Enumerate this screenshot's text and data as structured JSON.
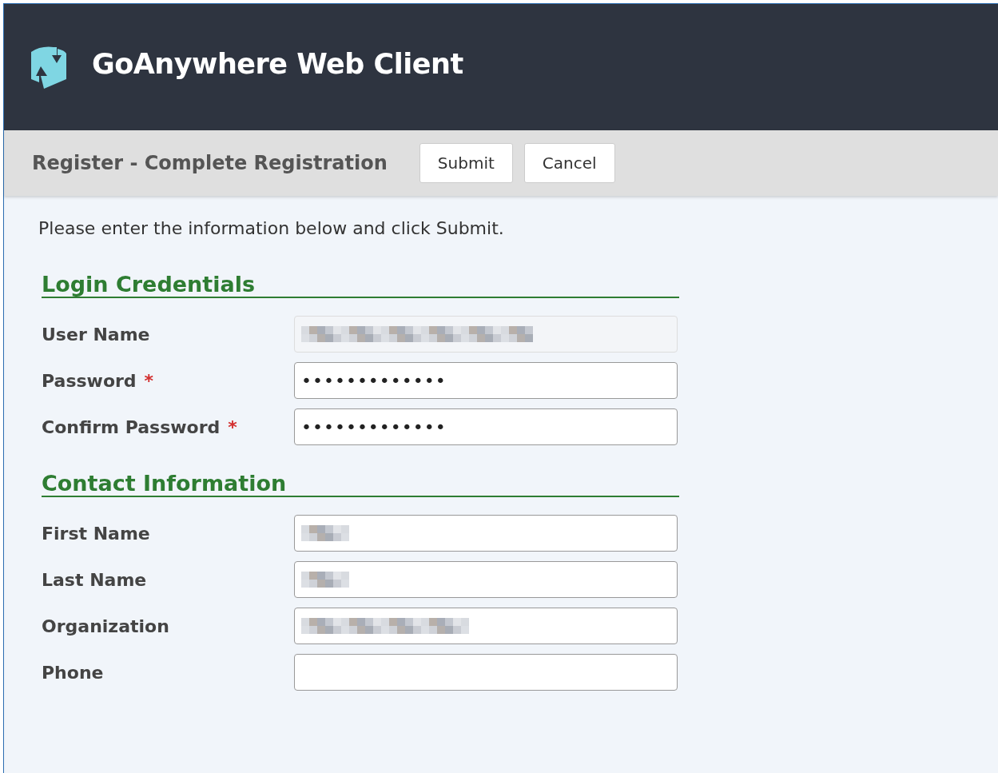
{
  "header": {
    "title": "GoAnywhere Web Client"
  },
  "toolbar": {
    "title": "Register - Complete Registration",
    "buttons": [
      "Submit",
      "Cancel"
    ]
  },
  "intro": "Please enter the information below and click Submit.",
  "sections": [
    {
      "title": "Login Credentials",
      "fields": [
        {
          "label": "User Name",
          "kind": "longblur",
          "disabled": true
        },
        {
          "label": "Password",
          "marker": "*",
          "kind": "text",
          "disabled": false,
          "value": "•••••••••••••"
        },
        {
          "label": "Confirm Password",
          "marker": "*",
          "kind": "text",
          "disabled": false,
          "value": "•••••••••••••"
        }
      ]
    },
    {
      "title": "Contact Information",
      "fields": [
        {
          "label": "First Name",
          "kind": "shortblur",
          "disabled": false
        },
        {
          "label": "Last Name",
          "kind": "shortblur",
          "disabled": false
        },
        {
          "label": "Organization",
          "kind": "midblur",
          "disabled": false
        },
        {
          "label": "Phone",
          "kind": "text",
          "disabled": false
        }
      ]
    }
  ]
}
